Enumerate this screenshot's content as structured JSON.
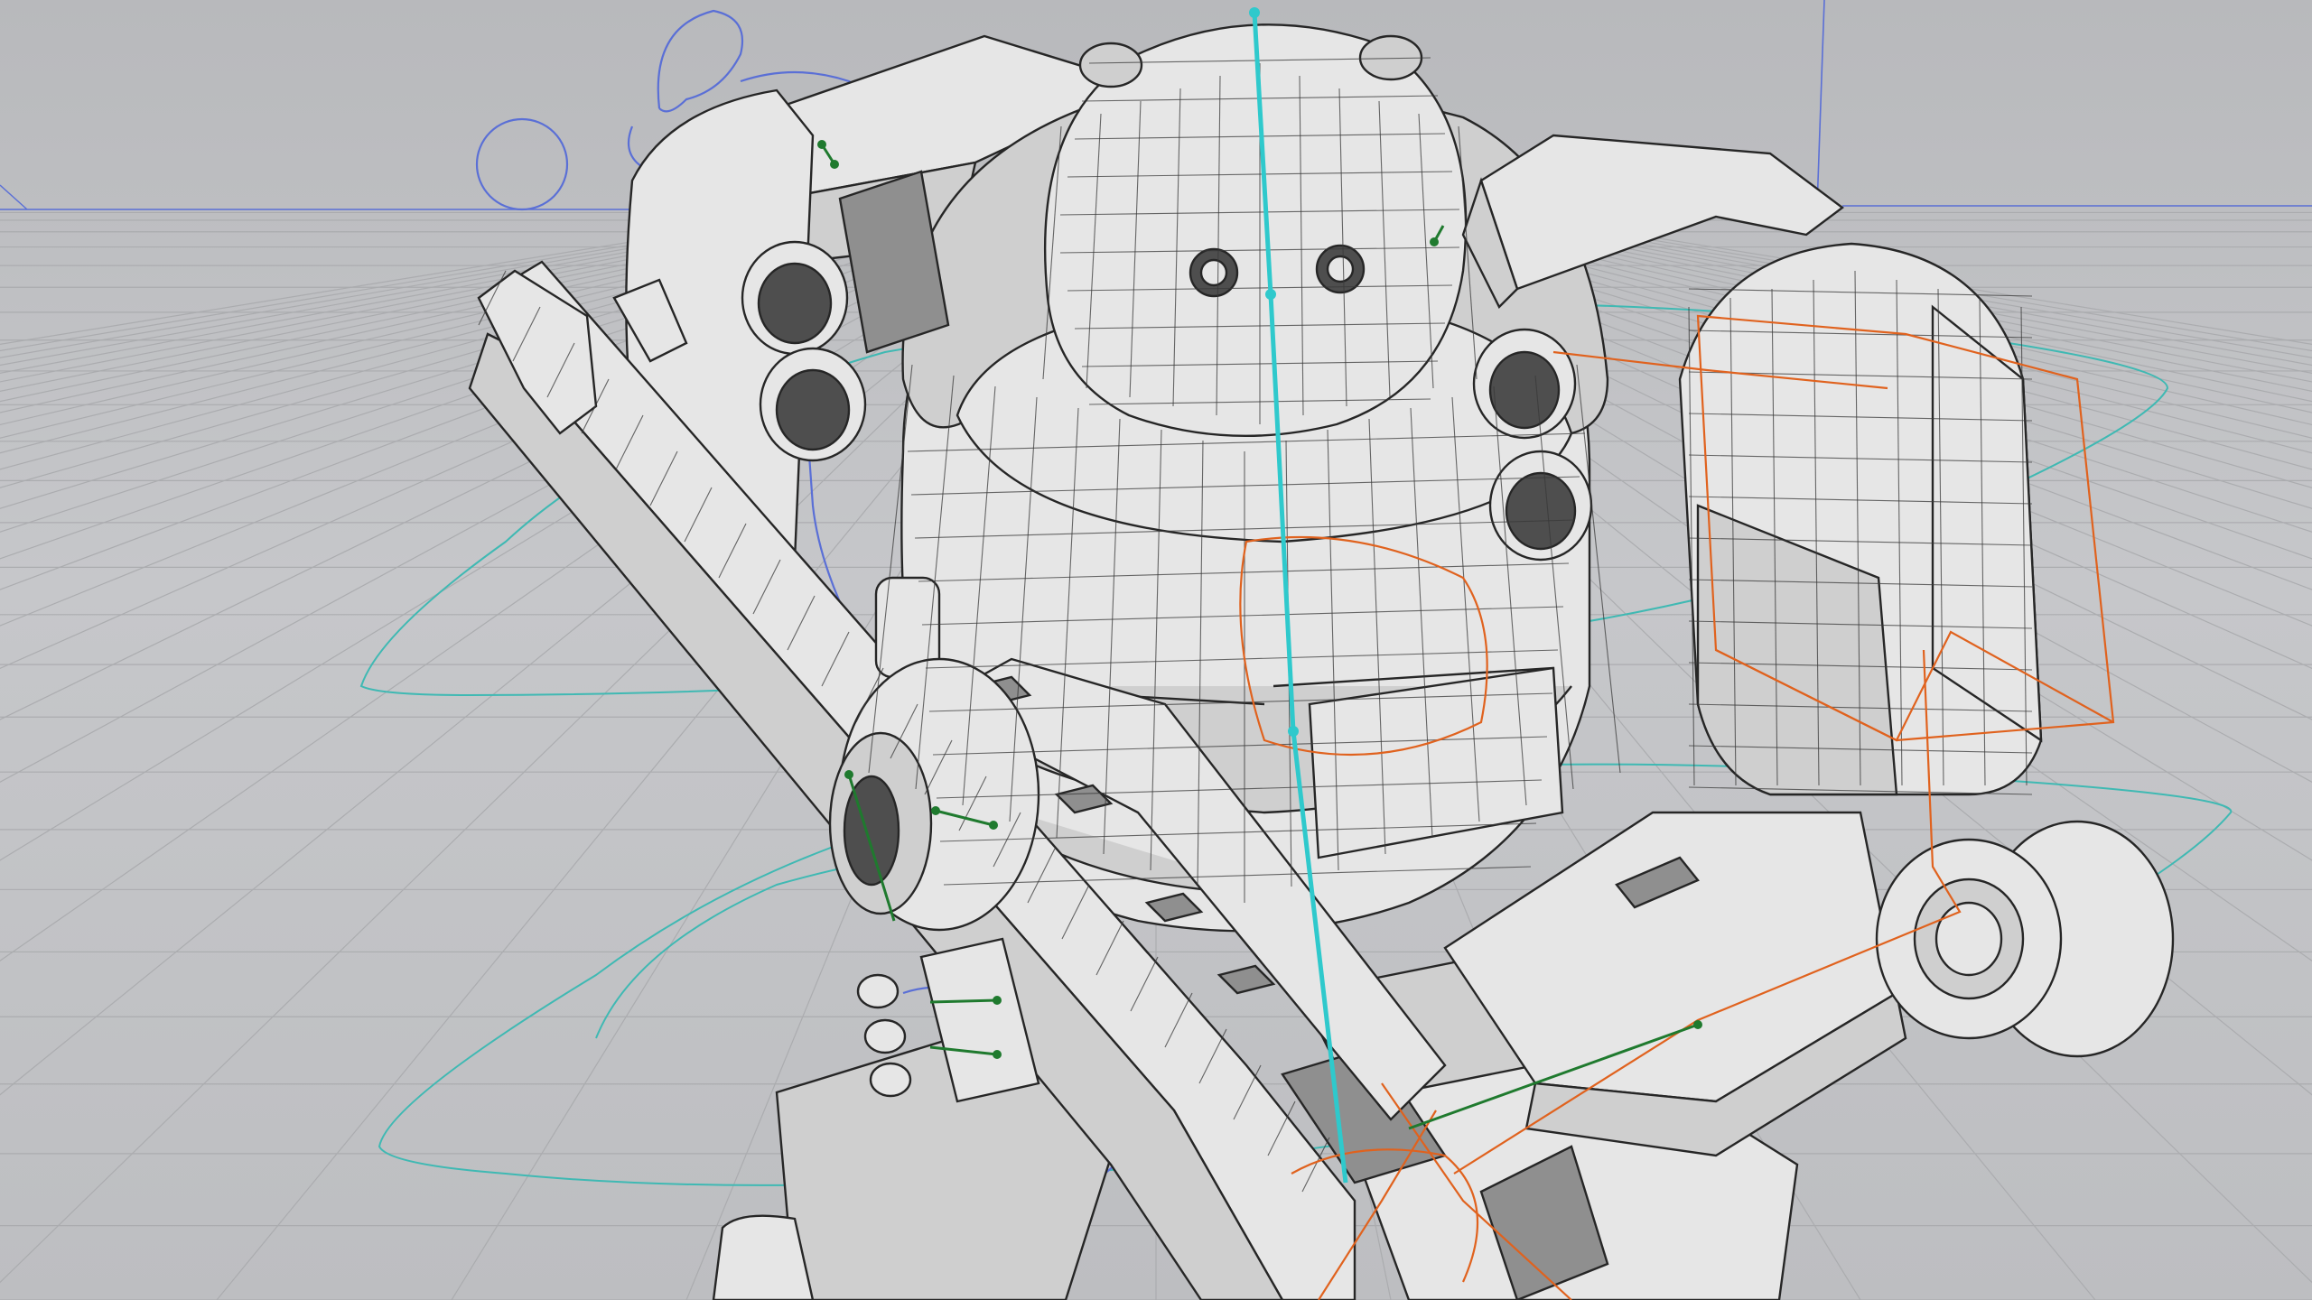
{
  "viewport": {
    "background_color": "#c0c1c4",
    "grid_color": "#a9aaad",
    "mesh_color": "#262626",
    "rig_colors": {
      "spine": "#2fc9cc",
      "left_arm_controls": "#5a6fd6",
      "right_arm_controls": "#e0621e",
      "control_curves": "#3fb9b3",
      "joints": "#1f7a2e"
    },
    "subject": "mech-robot-wireframe-with-rifle"
  }
}
